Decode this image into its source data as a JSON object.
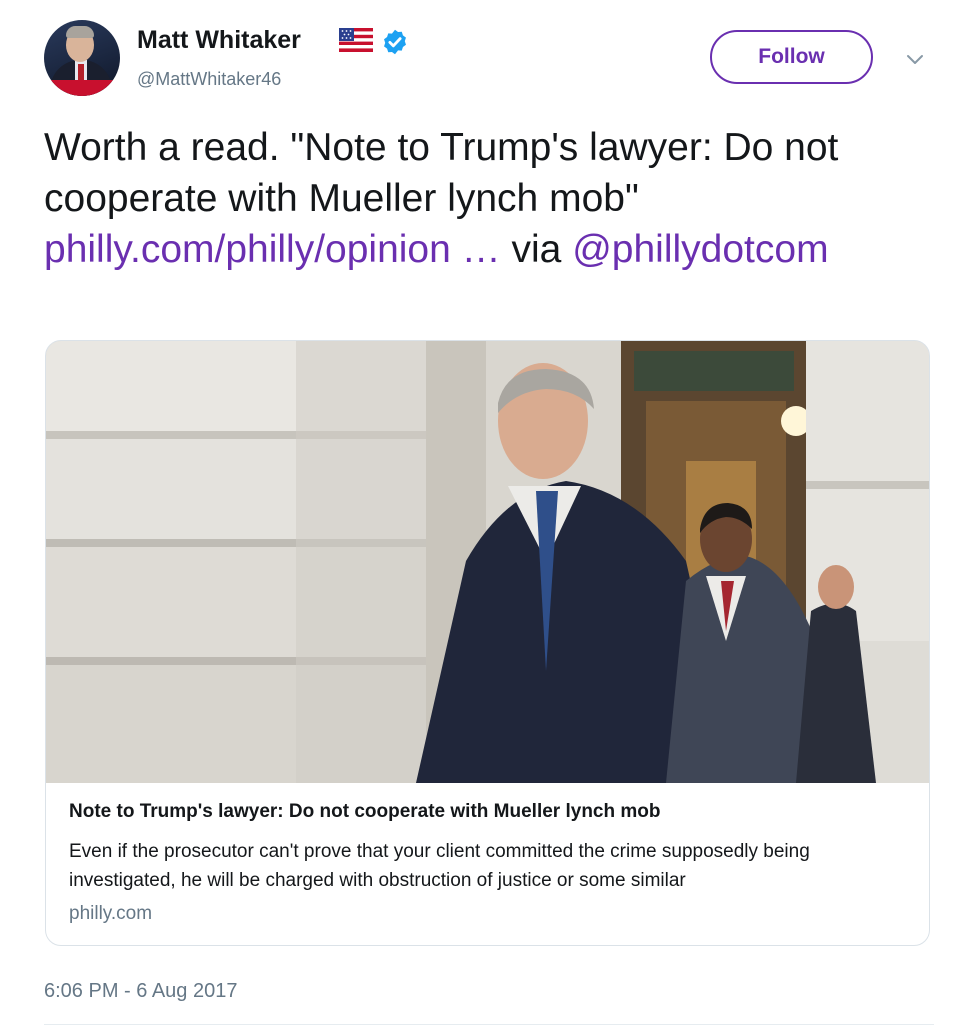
{
  "author": {
    "name": "Matt Whitaker",
    "handle": "@MattWhitaker46",
    "verified": true
  },
  "actions": {
    "follow_label": "Follow"
  },
  "tweet": {
    "text_before": "Worth a read.  \"Note to Trump's lawyer: Do not cooperate with Mueller lynch mob\" ",
    "url_text": "philly.com/philly/opinion",
    "ellipsis": " …",
    "via": " via ",
    "mention": "@phillydotcom",
    "timestamp": "6:06 PM - 6 Aug 2017"
  },
  "card": {
    "title": "Note to Trump's lawyer: Do not cooperate with Mueller lynch mob",
    "description": "Even if the prosecutor can't prove that your client committed the crime supposedly being investigated, he will be charged with obstruction of justice or some similar",
    "domain": "philly.com"
  },
  "colors": {
    "link": "#6a2fb0",
    "text": "#14171a",
    "muted": "#657786",
    "verified": "#1da1f2"
  },
  "icons": {
    "flag": "us-flag-icon",
    "verified": "verified-badge-icon",
    "menu": "chevron-down-icon"
  }
}
